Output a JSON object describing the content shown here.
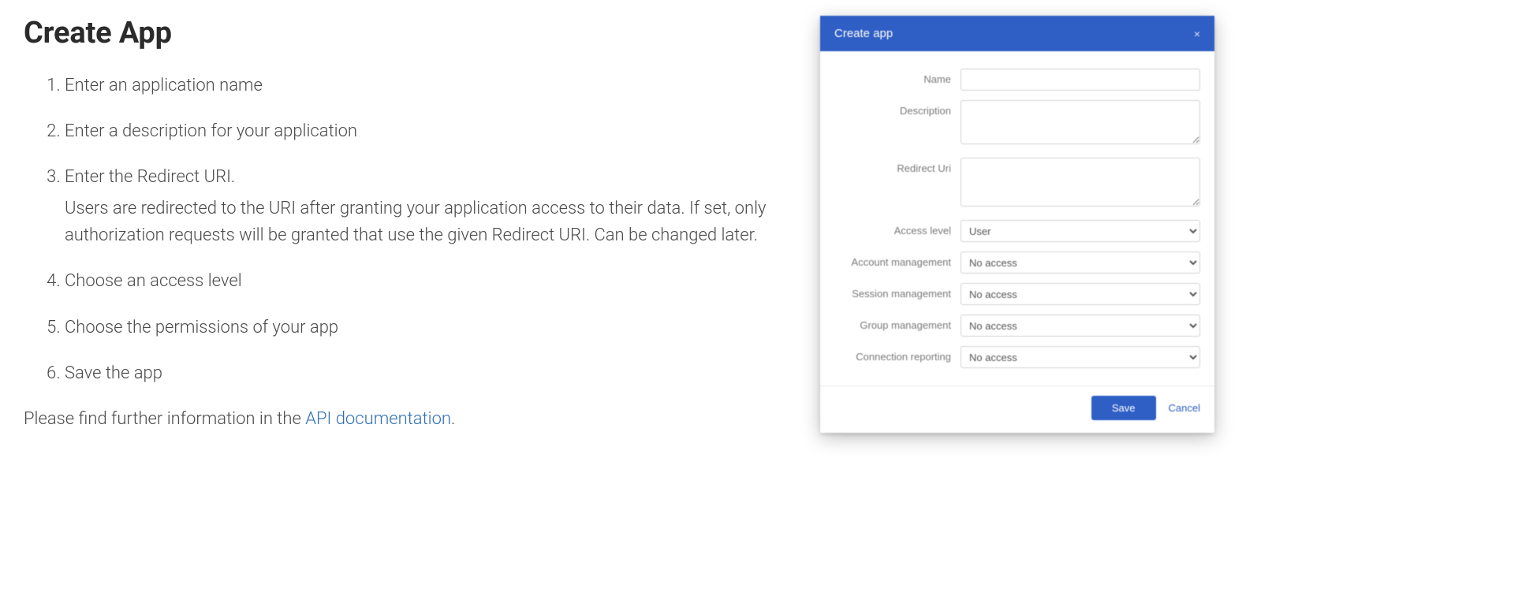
{
  "doc": {
    "title": "Create App",
    "steps": [
      "Enter an application name",
      "Enter a description for your application",
      "Enter the Redirect URI.",
      "Choose an access level",
      "Choose the permissions of your app",
      "Save the app"
    ],
    "step3_detail": "Users are redirected to the URI after granting your application access to their data. If set, only authorization requests will be granted that use the given Redirect URI. Can be changed later.",
    "footnote_prefix": "Please find further information in the ",
    "footnote_link": "API documentation",
    "footnote_suffix": "."
  },
  "modal": {
    "title": "Create app",
    "close_glyph": "×",
    "fields": {
      "name_label": "Name",
      "name_value": "",
      "description_label": "Description",
      "description_value": "",
      "redirect_label": "Redirect Uri",
      "redirect_value": "",
      "access_level_label": "Access level",
      "access_level_value": "User",
      "account_mgmt_label": "Account management",
      "account_mgmt_value": "No access",
      "session_mgmt_label": "Session management",
      "session_mgmt_value": "No access",
      "group_mgmt_label": "Group management",
      "group_mgmt_value": "No access",
      "connection_reporting_label": "Connection reporting",
      "connection_reporting_value": "No access"
    },
    "buttons": {
      "save": "Save",
      "cancel": "Cancel"
    }
  }
}
